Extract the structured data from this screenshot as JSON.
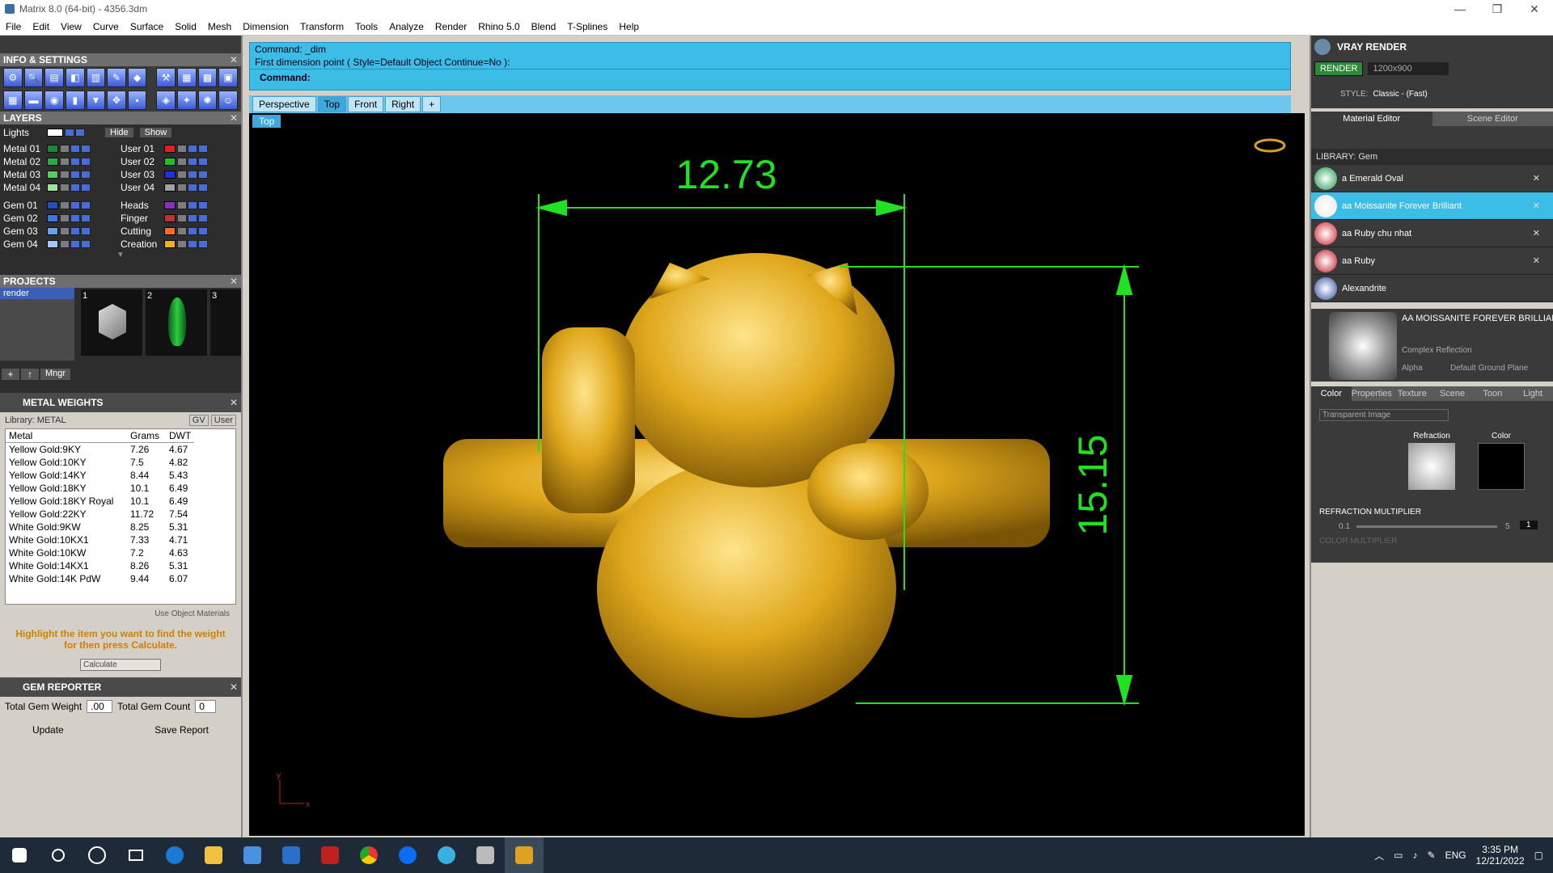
{
  "window": {
    "title": "Matrix 8.0 (64-bit) - 4356.3dm"
  },
  "menu": [
    "File",
    "Edit",
    "View",
    "Curve",
    "Surface",
    "Solid",
    "Mesh",
    "Dimension",
    "Transform",
    "Tools",
    "Analyze",
    "Render",
    "Rhino 5.0",
    "Blend",
    "T-Splines",
    "Help"
  ],
  "left": {
    "info_title": "INFO & SETTINGS",
    "layers_title": "LAYERS",
    "lights_label": "Lights",
    "hide_label": "Hide",
    "show_label": "Show",
    "layers_left": [
      {
        "name": "Metal 01",
        "color": "#1a8a3a"
      },
      {
        "name": "Metal 02",
        "color": "#22b04a"
      },
      {
        "name": "Metal 03",
        "color": "#4fd05a"
      },
      {
        "name": "Metal 04",
        "color": "#9be69b"
      },
      {
        "name": "Gem 01",
        "color": "#2050c0"
      },
      {
        "name": "Gem 02",
        "color": "#3a78e0"
      },
      {
        "name": "Gem 03",
        "color": "#68a0f0"
      },
      {
        "name": "Gem 04",
        "color": "#9cc8ff"
      }
    ],
    "layers_right": [
      {
        "name": "User 01",
        "color": "#e02020"
      },
      {
        "name": "User 02",
        "color": "#20c020"
      },
      {
        "name": "User 03",
        "color": "#2030e0"
      },
      {
        "name": "User 04",
        "color": "#a0a0a0"
      },
      {
        "name": "Heads",
        "color": "#8a30c0"
      },
      {
        "name": "Finger",
        "color": "#c03030"
      },
      {
        "name": "Cutting",
        "color": "#f07020"
      },
      {
        "name": "Creation",
        "color": "#f0b020"
      }
    ],
    "projects_title": "PROJECTS",
    "project_item": "render",
    "project_nums": [
      "1",
      "2",
      "3"
    ],
    "mngr_label": "Mngr",
    "metal_title": "METAL WEIGHTS",
    "library_label": "Library: METAL",
    "gv_label": "GV",
    "user_label": "User",
    "metal_headers": [
      "Metal",
      "Grams",
      "DWT"
    ],
    "metals": [
      [
        "Yellow Gold:9KY",
        "7.26",
        "4.67"
      ],
      [
        "Yellow Gold:10KY",
        "7.5",
        "4.82"
      ],
      [
        "Yellow Gold:14KY",
        "8.44",
        "5.43"
      ],
      [
        "Yellow Gold:18KY",
        "10.1",
        "6.49"
      ],
      [
        "Yellow Gold:18KY Royal",
        "10.1",
        "6.49"
      ],
      [
        "Yellow Gold:22KY",
        "11.72",
        "7.54"
      ],
      [
        "White Gold:9KW",
        "8.25",
        "5.31"
      ],
      [
        "White Gold:10KX1",
        "7.33",
        "4.71"
      ],
      [
        "White Gold:10KW",
        "7.2",
        "4.63"
      ],
      [
        "White Gold:14KX1",
        "8.26",
        "5.31"
      ],
      [
        "White Gold:14K PdW",
        "9.44",
        "6.07"
      ]
    ],
    "use_object": "Use Object Materials",
    "highlight_text": "Highlight the item you want to find the weight for then press Calculate.",
    "calculate": "Calculate",
    "gem_title": "GEM REPORTER",
    "total_weight_label": "Total Gem Weight",
    "total_weight_val": ".00",
    "total_count_label": "Total Gem Count",
    "total_count_val": "0",
    "update": "Update",
    "save_report": "Save Report"
  },
  "command": {
    "line1": "Command: _dim",
    "line2": "First dimension point ( Style=Default  Object  Continue=No ):",
    "prompt": "Command:"
  },
  "view_tabs": [
    "Perspective",
    "Top",
    "Front",
    "Right"
  ],
  "viewport_label": "Top",
  "dims": {
    "width": "12.73",
    "height": "15.15"
  },
  "axis": {
    "x": "x",
    "y": "y"
  },
  "right": {
    "vray_title": "VRAY RENDER",
    "render_btn": "RENDER",
    "resolution": "1200x900",
    "style_label": "STYLE:",
    "style_value": "Classic - (Fast)",
    "tab_material": "Material Editor",
    "tab_scene": "Scene Editor",
    "library_label": "LIBRARY: Gem",
    "materials": [
      {
        "name": "a Emerald Oval",
        "color": "#1a9a4a"
      },
      {
        "name": "aa Moissanite Forever Brilliant",
        "color": "#e8e8e8"
      },
      {
        "name": "aa Ruby chu nhat",
        "color": "#d02030"
      },
      {
        "name": "aa Ruby",
        "color": "#c01828"
      },
      {
        "name": "Alexandrite",
        "color": "#3050a0"
      }
    ],
    "selected_title": "AA MOISSANITE FOREVER BRILLIANT",
    "complex": "Complex Reflection",
    "alpha": "Alpha",
    "ground": "Default Ground Plane",
    "subtabs": [
      "Color",
      "Properties",
      "Texture",
      "Scene",
      "Toon",
      "Light"
    ],
    "transparent": "Transparent Image",
    "refraction": "Refraction",
    "color": "Color",
    "refraction_mult": "REFRACTION MULTIPLIER",
    "color_mult": "COLOR MULTIPLIER",
    "slider_min": "0.1",
    "slider_max": "5",
    "slider_val": "1"
  },
  "taskbar": {
    "lang": "ENG",
    "time": "3:35 PM",
    "date": "12/21/2022"
  }
}
